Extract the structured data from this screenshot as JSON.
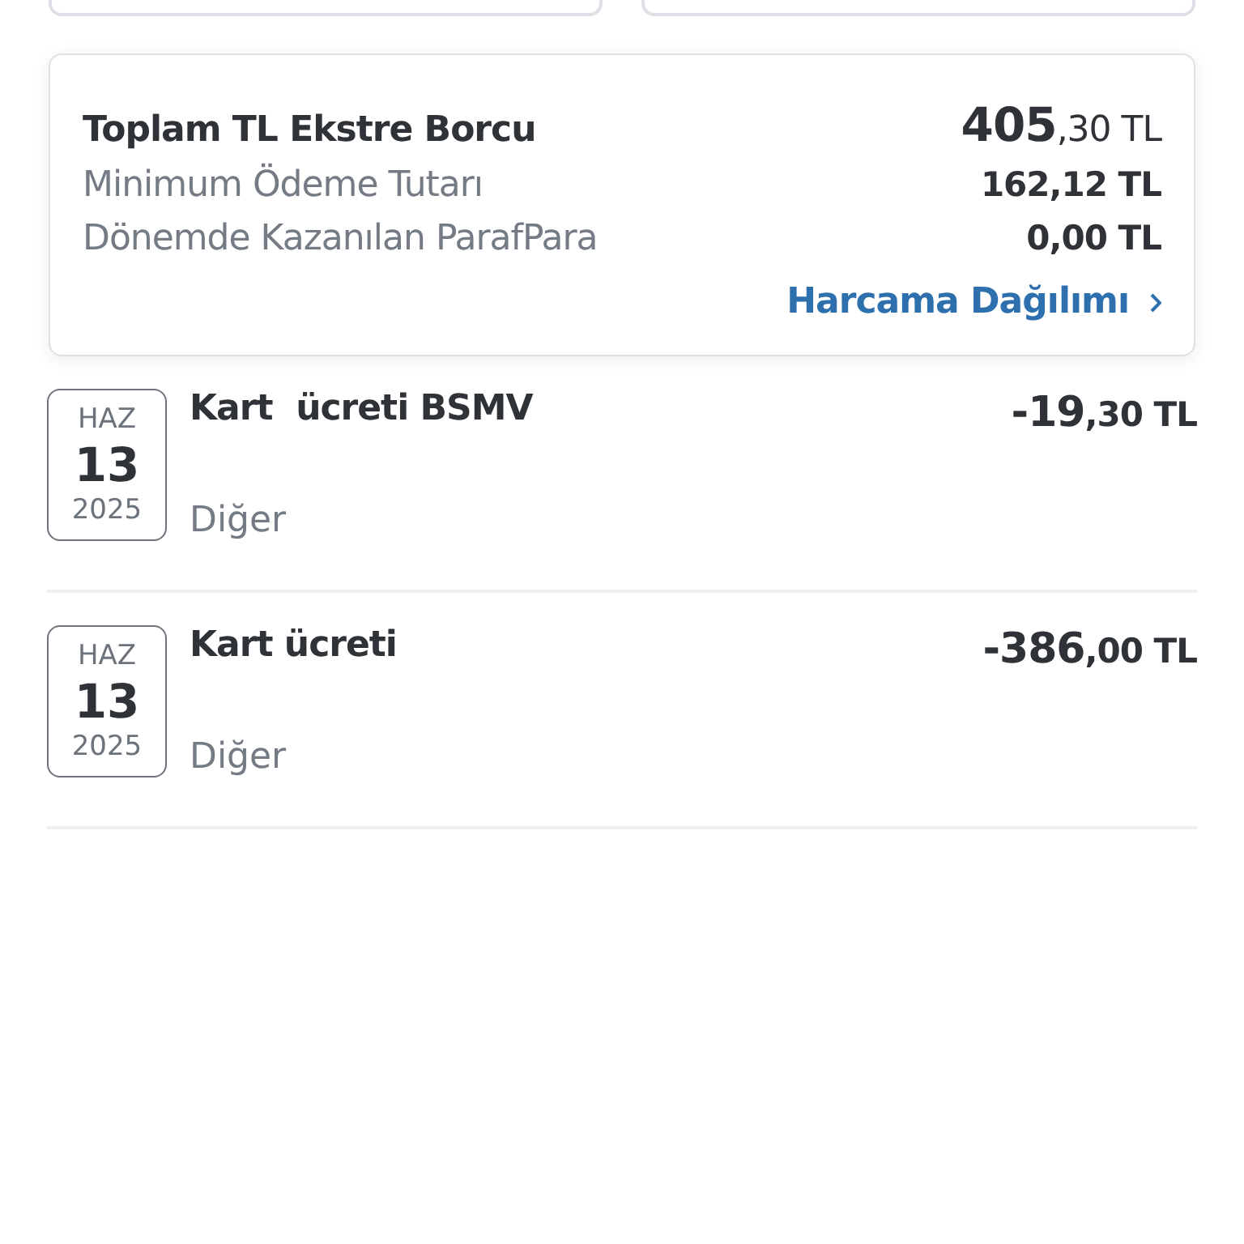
{
  "summary": {
    "title": "Toplam TL Ekstre Borcu",
    "total": "**405**,30 TL",
    "lines": [
      {
        "label": "Minimum Ödeme Tutarı",
        "value": "162,12 TL"
      },
      {
        "label": "Dönemde Kazanılan ParafPara",
        "value": "0,00 TL"
      }
    ],
    "link": "Harcama Dağılımı"
  },
  "transactions": [
    {
      "month": "HAZ",
      "day": "13",
      "year": "2025",
      "title": "Kart  ücreti BSMV",
      "category": "Diğer",
      "amount": "**-19**,30 TL"
    },
    {
      "month": "HAZ",
      "day": "13",
      "year": "2025",
      "title": "Kart ücreti",
      "category": "Diğer",
      "amount": "**-386**,00 TL"
    }
  ]
}
